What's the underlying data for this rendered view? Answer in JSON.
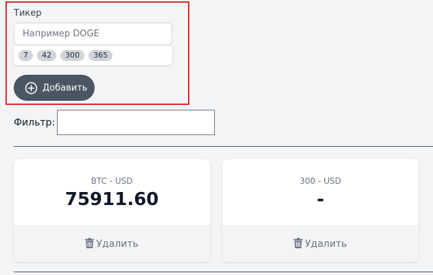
{
  "add_ticker": {
    "label": "Тикер",
    "input_placeholder": "Например DOGE",
    "input_value": "",
    "suggestions": [
      "7",
      "42",
      "300",
      "365"
    ],
    "add_button_label": "Добавить"
  },
  "filter": {
    "label": "Фильтр:",
    "value": ""
  },
  "cards": [
    {
      "title": "BTC - USD",
      "price": "75911.60",
      "delete_label": "Удалить"
    },
    {
      "title": "300 - USD",
      "price": "-",
      "delete_label": "Удалить"
    }
  ],
  "colors": {
    "highlight_border": "#dc2626",
    "button_bg": "#4b5563",
    "page_bg": "#f3f4f6"
  },
  "icons": [
    "plus-circle-icon",
    "trash-icon"
  ]
}
